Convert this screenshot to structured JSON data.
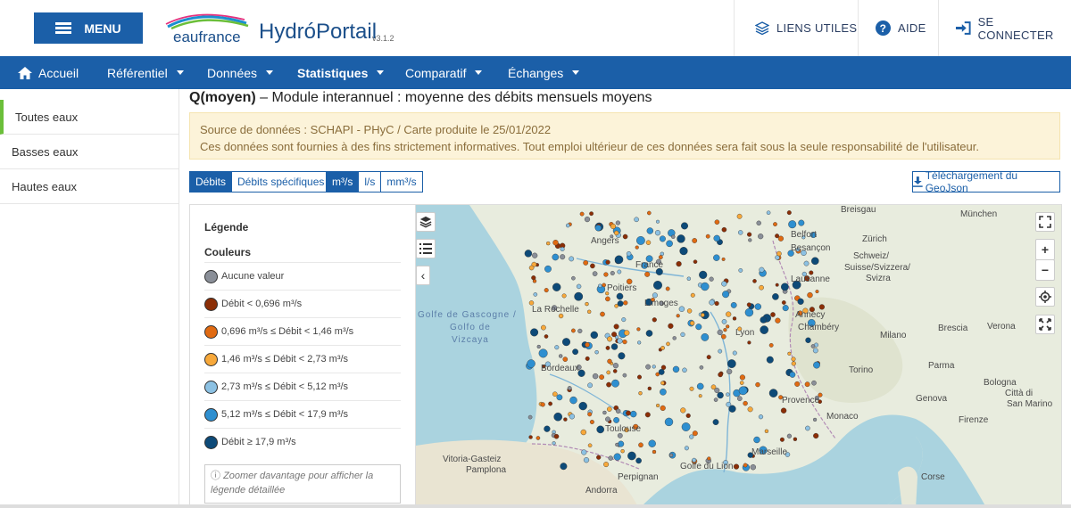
{
  "header": {
    "menu_label": "MENU",
    "brand_eau": "eaufrance",
    "brand_hydro": "HydróPortail",
    "version": "v3.1.2",
    "links": [
      {
        "label": "LIENS UTILES",
        "icon": "layers-icon"
      },
      {
        "label": "AIDE",
        "icon": "question-circle-icon"
      },
      {
        "label": "SE CONNECTER",
        "icon": "sign-in-icon"
      }
    ]
  },
  "nav": {
    "items": [
      {
        "label": "Accueil",
        "icon": "home-icon",
        "dropdown": false
      },
      {
        "label": "Référentiel",
        "dropdown": true
      },
      {
        "label": "Données",
        "dropdown": true
      },
      {
        "label": "Statistiques",
        "dropdown": true,
        "active": true
      },
      {
        "label": "Comparatif",
        "dropdown": true
      },
      {
        "label": "Échanges",
        "dropdown": true
      }
    ],
    "bg_color": "#1b5fa8"
  },
  "sidebar": {
    "items": [
      {
        "label": "Toutes eaux",
        "active": true
      },
      {
        "label": "Basses eaux"
      },
      {
        "label": "Hautes eaux"
      }
    ]
  },
  "page": {
    "title_code": "Q(moyen)",
    "title_rest": " – Module interannuel : moyenne des débits mensuels moyens"
  },
  "alert": {
    "line1": "Source de données : SCHAPI - PHyC / Carte produite le 25/01/2022",
    "line2": "Ces données sont fournies à des fins strictement informatives. Tout emploi ultérieur de ces données sera fait sous la seule responsabilité de l'utilisateur."
  },
  "toggles": {
    "type": [
      "Débits",
      "Débits spécifiques"
    ],
    "type_selected": "Débits",
    "units": [
      "m³/s",
      "l/s",
      "mm³/s"
    ],
    "unit_selected": "m³/s",
    "download_label": "Téléchargement du GeoJson"
  },
  "legend": {
    "title": "Légende",
    "subtitle": "Couleurs",
    "rows": [
      {
        "label": "Aucune valeur",
        "color": "#8a8f98"
      },
      {
        "label": "Débit < 0,696 m³/s",
        "color": "#8b2e06"
      },
      {
        "label": "0,696 m³/s ≤ Débit < 1,46 m³/s",
        "color": "#e06a12"
      },
      {
        "label": "1,46 m³/s ≤ Débit < 2,73 m³/s",
        "color": "#f7a83a"
      },
      {
        "label": "2,73 m³/s ≤ Débit < 5,12 m³/s",
        "color": "#8cc1e3"
      },
      {
        "label": "5,12 m³/s ≤ Débit < 17,9 m³/s",
        "color": "#2e8fd0"
      },
      {
        "label": "Débit ≥ 17,9 m³/s",
        "color": "#0d4a78"
      }
    ],
    "note": "Zoomer davantage pour afficher la légende détaillée"
  },
  "map": {
    "places": [
      "Breisgau",
      "München",
      "Belfort",
      "Zürich",
      "Angers",
      "France",
      "Besançon",
      "Schweiz/",
      "Suisse/Svizzera/",
      "Svizra",
      "Lausanne",
      "Poitiers",
      "Limoges",
      "La Rochelle",
      "Golfe de Gascogne /",
      "Golfo de",
      "Vizcaya",
      "Annecy",
      "Chambéry",
      "Lyon",
      "Bordeaux",
      "Brescia",
      "Verona",
      "Milano",
      "Torino",
      "Parma",
      "Genova",
      "Bologna",
      "Città di",
      "San Marino",
      "Firenze",
      "Toulouse",
      "Provence",
      "Monaco",
      "Vitoria-Gasteiz",
      "Marseille",
      "Golfe du Lion",
      "Corse",
      "Perpignan",
      "Andorra",
      "Pamplona"
    ],
    "controls": [
      "layers-icon",
      "list-icon",
      "collapse-icon",
      "fullscreen-icon",
      "zoom-in-icon",
      "zoom-out-icon",
      "locate-icon",
      "expand-icon"
    ]
  }
}
